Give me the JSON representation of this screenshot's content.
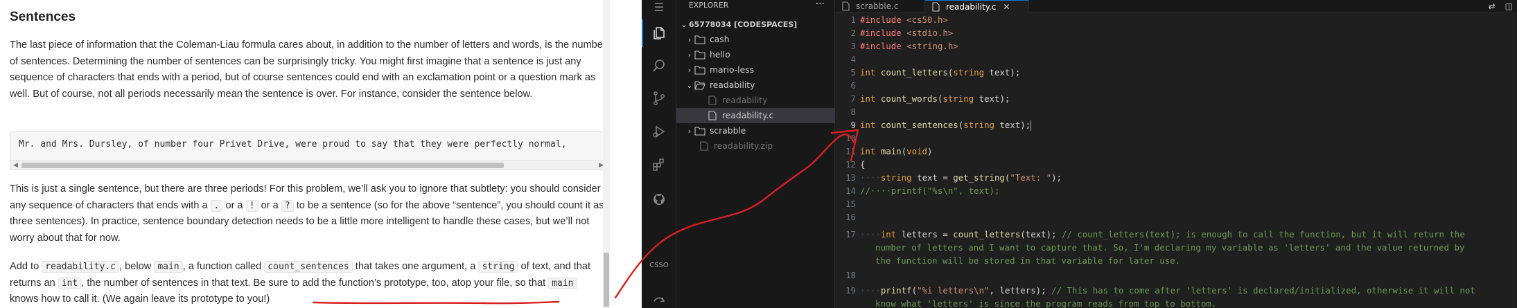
{
  "doc": {
    "heading": "Sentences",
    "p1": "The last piece of information that the Coleman-Liau formula cares about, in addition to the number of letters and words, is the number of sentences. Determining the number of sentences can be surprisingly tricky. You might first imagine that a sentence is just any sequence of characters that ends with a period, but of course sentences could end with an exclamation point or a question mark as well. But of course, not all periods necessarily mean the sentence is over. For instance, consider the sentence below.",
    "example_code": "Mr. and Mrs. Dursley, of number four Privet Drive, were proud to say that they were perfectly normal,",
    "p2": {
      "a": "This is just a single sentence, but there are three periods! For this problem, we’ll ask you to ignore that subtlety: you should consider any sequence of characters that ends with a",
      "c1": ".",
      "or1": "or a",
      "c2": "!",
      "or2": "or a",
      "c3": "?",
      "b": "to be a sentence (so for the above “sentence”, you should count it as three sentences). In practice, sentence boundary detection needs to be a little more intelligent to handle these cases, but we’ll not worry about that for now."
    },
    "p3": {
      "t1": "Add to",
      "c_file": "readability.c",
      "t2": ", below",
      "c_main": "main",
      "t3": ", a function called",
      "c_fn": "count_sentences",
      "t4": "that takes one argument, a",
      "c_string": "string",
      "t5": "of text, and that returns an",
      "c_int": "int",
      "t6": ", the number of sentences in that text. Be sure to",
      "underlined": "add the function’s prototype, too, atop your file",
      "t7": ", so that",
      "c_main2": "main",
      "t8": "knows how to call it. (We again leave its prototype to you!)"
    }
  },
  "vscode": {
    "explorer_title": "EXPLORER",
    "more_glyph": "···",
    "workspace": "65778034 [CODESPACES]",
    "tree": [
      {
        "label": "cash",
        "type": "folder",
        "open": false
      },
      {
        "label": "hello",
        "type": "folder",
        "open": false
      },
      {
        "label": "mario-less",
        "type": "folder",
        "open": false
      },
      {
        "label": "readability",
        "type": "folder",
        "open": true
      },
      {
        "label": "readability",
        "type": "file",
        "dim": true
      },
      {
        "label": "readability.c",
        "type": "file",
        "selected": true
      },
      {
        "label": "scrabble",
        "type": "folder",
        "open": false
      },
      {
        "label": "readability.zip",
        "type": "file",
        "dim": true
      }
    ],
    "tabs": [
      {
        "label": "scrabble.c",
        "active": false
      },
      {
        "label": "readability.c",
        "active": true
      }
    ],
    "activity_label": "CSSO",
    "current_line": 9
  }
}
